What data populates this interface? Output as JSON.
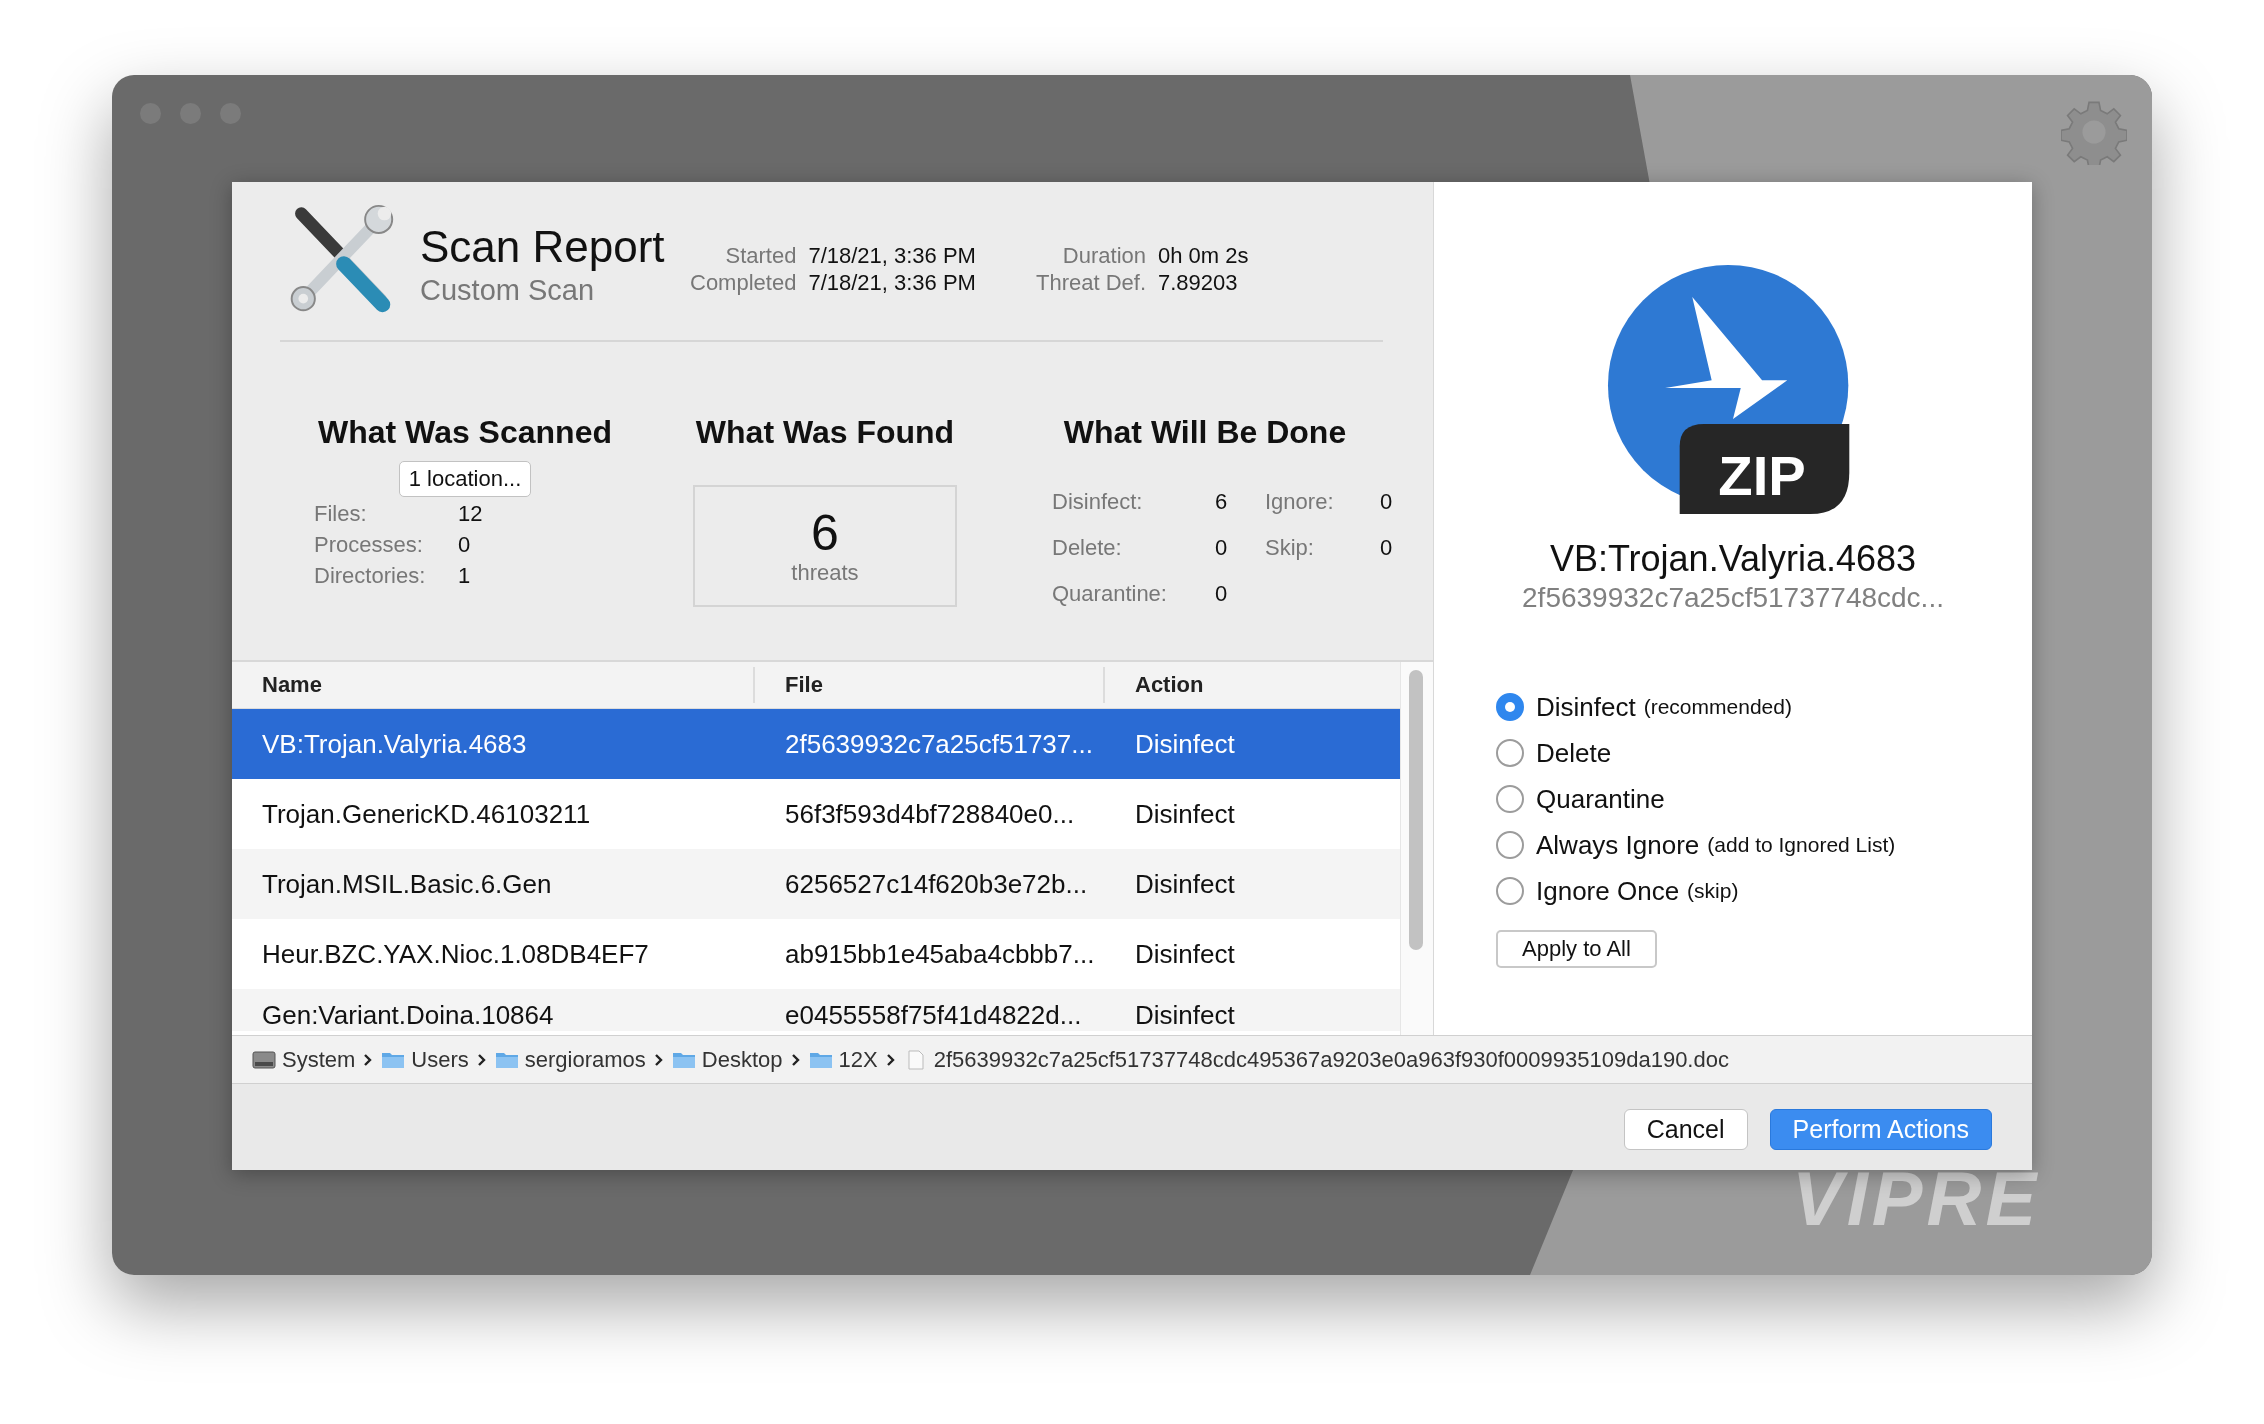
{
  "brand_logo": "VIPRE",
  "header": {
    "title": "Scan Report",
    "subtitle": "Custom Scan",
    "meta_columns": [
      [
        {
          "label": "Started",
          "value": "7/18/21, 3:36 PM"
        },
        {
          "label": "Completed",
          "value": "7/18/21, 3:36 PM"
        }
      ],
      [
        {
          "label": "Duration",
          "value": "0h 0m 2s"
        },
        {
          "label": "Threat Def.",
          "value": "7.89203"
        }
      ]
    ]
  },
  "scanned": {
    "title": "What Was Scanned",
    "button": "1 location...",
    "stats": [
      {
        "label": "Files:",
        "value": "12"
      },
      {
        "label": "Processes:",
        "value": "0"
      },
      {
        "label": "Directories:",
        "value": "1"
      }
    ]
  },
  "found": {
    "title": "What Was Found",
    "count": "6",
    "unit": "threats"
  },
  "done": {
    "title": "What Will Be Done",
    "stats": [
      {
        "label": "Disinfect:",
        "value": "6"
      },
      {
        "label": "Ignore:",
        "value": "0"
      },
      {
        "label": "Delete:",
        "value": "0"
      },
      {
        "label": "Skip:",
        "value": "0"
      },
      {
        "label": "Quarantine:",
        "value": "0"
      }
    ]
  },
  "table": {
    "columns": [
      "Name",
      "File",
      "Action"
    ],
    "rows": [
      {
        "name": "VB:Trojan.Valyria.4683",
        "file": "2f5639932c7a25cf51737...",
        "action": "Disinfect",
        "selected": true
      },
      {
        "name": "Trojan.GenericKD.46103211",
        "file": "56f3f593d4bf728840e0...",
        "action": "Disinfect",
        "selected": false
      },
      {
        "name": "Trojan.MSIL.Basic.6.Gen",
        "file": "6256527c14f620b3e72b...",
        "action": "Disinfect",
        "selected": false
      },
      {
        "name": "Heur.BZC.YAX.Nioc.1.08DB4EF7",
        "file": "ab915bb1e45aba4cbbb7...",
        "action": "Disinfect",
        "selected": false
      },
      {
        "name": "Gen:Variant.Doina.10864",
        "file": "e0455558f75f41d4822d...",
        "action": "Disinfect",
        "selected": false
      }
    ]
  },
  "detail": {
    "file_type": "ZIP",
    "name": "VB:Trojan.Valyria.4683",
    "hash": "2f5639932c7a25cf51737748cdc...",
    "options": [
      {
        "label": "Disinfect",
        "note": "(recommended)",
        "selected": true
      },
      {
        "label": "Delete",
        "selected": false
      },
      {
        "label": "Quarantine",
        "selected": false
      },
      {
        "label": "Always Ignore",
        "note": "(add to Ignored List)",
        "selected": false
      },
      {
        "label": "Ignore Once",
        "note": "(skip)",
        "selected": false
      }
    ],
    "apply_button": "Apply to All"
  },
  "breadcrumb": [
    {
      "label": "System",
      "kind": "disk"
    },
    {
      "label": "Users",
      "kind": "folder"
    },
    {
      "label": "sergioramos",
      "kind": "folder"
    },
    {
      "label": "Desktop",
      "kind": "folder"
    },
    {
      "label": "12X",
      "kind": "folder"
    },
    {
      "label": "2f5639932c7a25cf51737748cdc495367a9203e0a963f930f0009935109da190.doc",
      "kind": "file"
    }
  ],
  "buttons": [
    {
      "label": "Cancel",
      "kind": "default"
    },
    {
      "label": "Perform Actions",
      "kind": "primary"
    }
  ]
}
